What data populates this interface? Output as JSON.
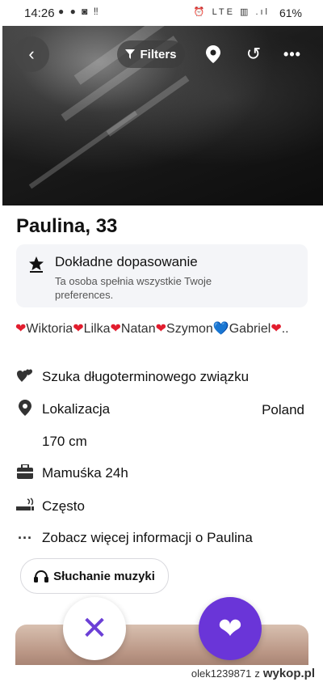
{
  "status_bar": {
    "time": "14:26",
    "left_icons": "● ● ◙ ‼",
    "right_icons": "⏰ LTE ▥ .ıl",
    "battery": "61%"
  },
  "top_bar": {
    "back_icon": "‹",
    "filters_label": "Filters",
    "filter_icon": "filter-icon",
    "pin_icon": "location-pin-icon",
    "undo_icon": "↺",
    "more_icon": "•••"
  },
  "profile": {
    "name_age": "Paulina, 33",
    "match": {
      "title": "Dokładne dopasowanie",
      "description": "Ta osoba spełnia wszystkie Twoje preferences."
    },
    "names_line": [
      {
        "heart": "❤",
        "color": "red",
        "name": "Wiktoria"
      },
      {
        "heart": "❤",
        "color": "red",
        "name": "Lilka"
      },
      {
        "heart": "❤",
        "color": "red",
        "name": "Natan"
      },
      {
        "heart": "❤",
        "color": "red",
        "name": "Szymon"
      },
      {
        "heart": "💙",
        "color": "blue",
        "name": "Gabriel"
      },
      {
        "heart": "❤",
        "color": "red",
        "name": ".."
      }
    ],
    "info": {
      "relationship": "Szuka długoterminowego związku",
      "location_label": "Lokalizacja",
      "location_value": "Poland",
      "height": "170 cm",
      "job": "Mamuśka 24h",
      "smoking": "Często",
      "see_more": "Zobacz więcej informacji o Paulina"
    },
    "interest_chip": "Słuchanie muzyki"
  },
  "actions": {
    "dislike_icon": "✕",
    "like_icon": "❤"
  },
  "watermark": {
    "user": "olek1239871",
    "sep": "z",
    "site": "wykop.pl"
  },
  "colors": {
    "accent": "#6a35d8",
    "heart_red": "#e21d2e",
    "heart_blue": "#4aa6ee",
    "card_bg": "#f4f5f8"
  }
}
